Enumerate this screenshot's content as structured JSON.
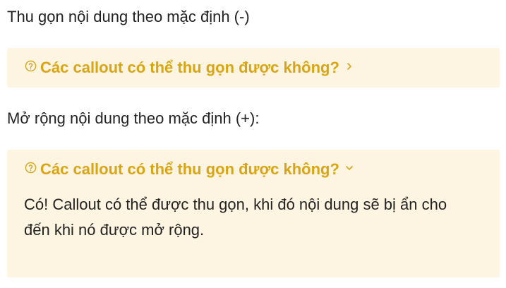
{
  "collapsed_section": {
    "intro": "Thu gọn nội dung theo mặc định (-)",
    "callout": {
      "icon": "help-circle-icon",
      "title": "Các callout có thể thu gọn được không?",
      "chevron": "chevron-right-icon"
    }
  },
  "expanded_section": {
    "intro": "Mở rộng nội dung theo mặc định (+):",
    "callout": {
      "icon": "help-circle-icon",
      "title": "Các callout có thể thu gọn được không?",
      "chevron": "chevron-down-icon",
      "body_line1": "Có! Callout có thể được thu gọn, khi đó nội dung sẽ bị ẩn cho",
      "body_line2": "đến khi nó được mở rộng."
    }
  },
  "colors": {
    "callout_background": "#fdf4e2",
    "callout_accent": "#d9a514",
    "text": "#222222"
  }
}
